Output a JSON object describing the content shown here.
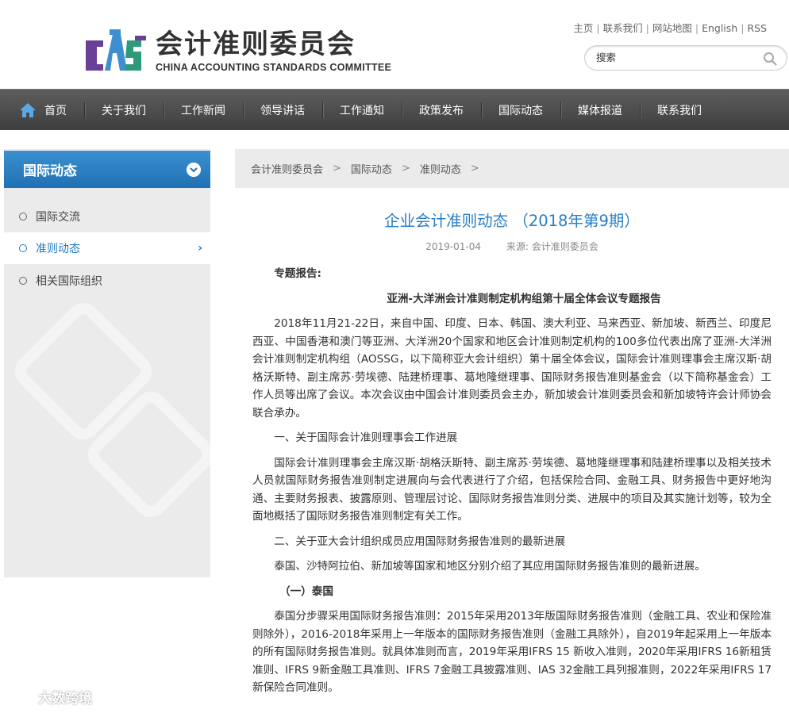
{
  "site": {
    "name_cn": "会计准则委员会",
    "name_en": "CHINA ACCOUNTING STANDARDS COMMITTEE",
    "logo_letters": "CASC"
  },
  "toplinks": [
    "主页",
    "联系我们",
    "网站地图",
    "English",
    "RSS"
  ],
  "search": {
    "placeholder": "搜索"
  },
  "nav": [
    "首页",
    "关于我们",
    "工作新闻",
    "领导讲话",
    "工作通知",
    "政策发布",
    "国际动态",
    "媒体报道",
    "联系我们"
  ],
  "sidebar": {
    "title": "国际动态",
    "items": [
      {
        "label": "国际交流",
        "active": false
      },
      {
        "label": "准则动态",
        "active": true
      },
      {
        "label": "相关国际组织",
        "active": false
      }
    ]
  },
  "breadcrumb": [
    "会计准则委员会",
    "国际动态",
    "准则动态"
  ],
  "article": {
    "title": "企业会计准则动态 （2018年第9期）",
    "date": "2019-01-04",
    "source": "来源: 会计准则委员会",
    "section_label": "专题报告:",
    "report_title": "亚洲-大洋洲会计准则制定机构组第十届全体会议专题报告",
    "p1": "2018年11月21-22日，来自中国、印度、日本、韩国、澳大利亚、马来西亚、新加坡、新西兰、印度尼西亚、中国香港和澳门等亚洲、大洋洲20个国家和地区会计准则制定机构的100多位代表出席了亚洲-大洋洲会计准则制定机构组（AOSSG，以下简称亚大会计组织）第十届全体会议，国际会计准则理事会主席汉斯·胡格沃斯特、副主席苏·劳埃德、陆建桥理事、葛地隆继理事、国际财务报告准则基金会（以下简称基金会）工作人员等出席了会议。本次会议由中国会计准则委员会主办，新加坡会计准则委员会和新加坡特许会计师协会联合承办。",
    "h1": "一、关于国际会计准则理事会工作进展",
    "p2": "国际会计准则理事会主席汉斯·胡格沃斯特、副主席苏·劳埃德、葛地隆继理事和陆建桥理事以及相关技术人员就国际财务报告准则制定进展向与会代表进行了介绍，包括保险合同、金融工具、财务报告中更好地沟通、主要财务报表、披露原则、管理层讨论、国际财务报告准则分类、进展中的项目及其实施计划等，较为全面地概括了国际财务报告准则制定有关工作。",
    "h2": "二、关于亚大会计组织成员应用国际财务报告准则的最新进展",
    "p3": "泰国、沙特阿拉伯、新加坡等国家和地区分别介绍了其应用国际财务报告准则的最新进展。",
    "h3": "（一）泰国",
    "p4": "泰国分步骤采用国际财务报告准则：2015年采用2013年版国际财务报告准则（金融工具、农业和保险准则除外），2016-2018年采用上一年版本的国际财务报告准则（金融工具除外），自2019年起采用上一年版本的所有国际财务报告准则。就具体准则而言，2019年采用IFRS 15 新收入准则，2020年采用IFRS 16新租赁准则、IFRS 9新金融工具准则、IFRS 7金融工具披露准则、IAS 32金融工具列报准则，2022年采用IFRS 17新保险合同准则。"
  },
  "watermark": "大数跨境",
  "colors": {
    "accent": "#2a7fc4",
    "nav_bg": "#4a4a4a",
    "sidebar_bg": "#ebebeb"
  }
}
